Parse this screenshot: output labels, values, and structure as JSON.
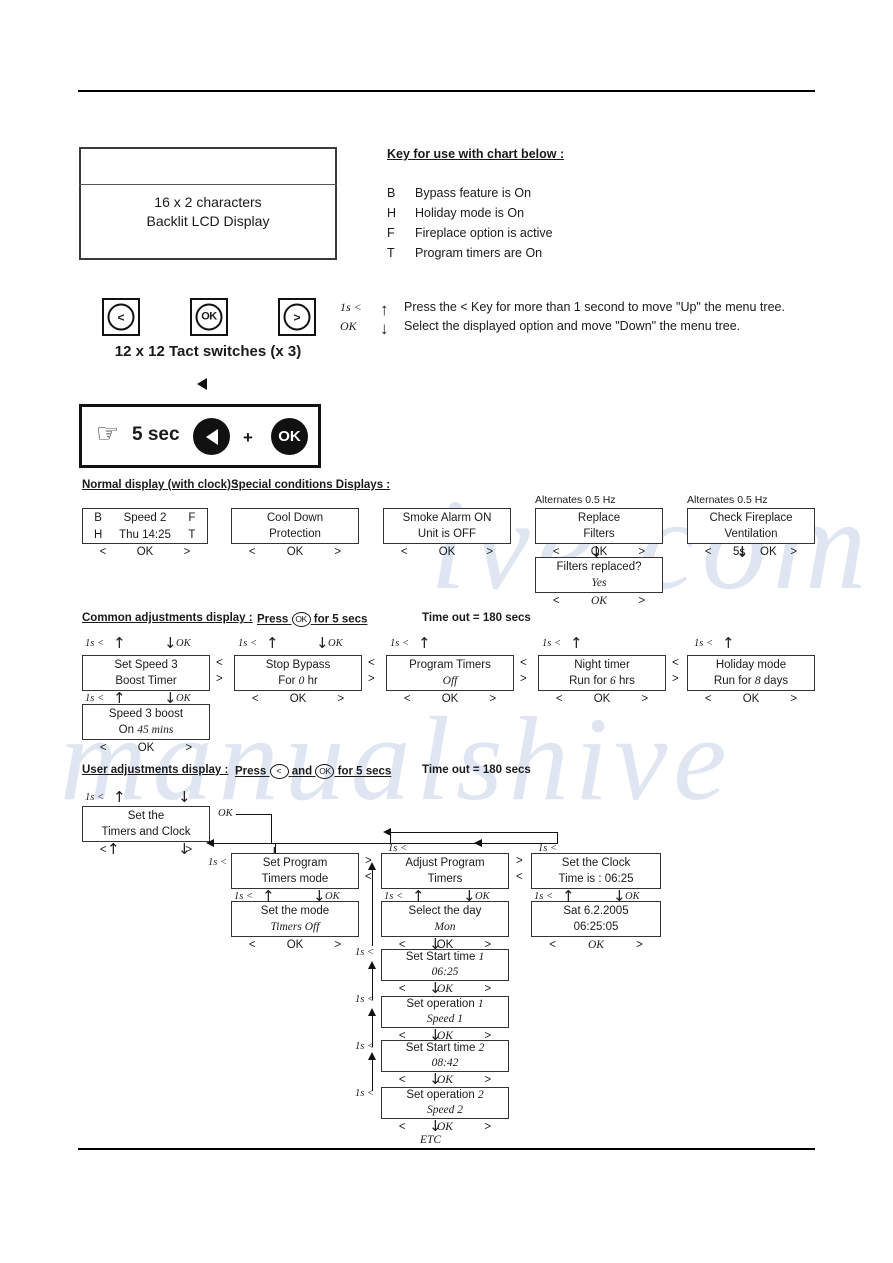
{
  "lcd_panel": {
    "caption_line1": "16 x 2 characters",
    "caption_line2": "Backlit LCD Display"
  },
  "key_legend": {
    "title": "Key for use with chart below :",
    "rows": [
      {
        "letter": "B",
        "desc": "Bypass feature is On"
      },
      {
        "letter": "H",
        "desc": "Holiday mode is On"
      },
      {
        "letter": "F",
        "desc": "Fireplace option is active"
      },
      {
        "letter": "T",
        "desc": "Program timers are On"
      }
    ]
  },
  "switches": {
    "left_label": "<",
    "ok_label": "OK",
    "right_label": ">",
    "caption": "12 x 12 Tact switches (x 3)"
  },
  "instructions": [
    {
      "tag": "1s <",
      "arrow": "↑",
      "text": "Press the  <  Key for more than 1 second to move \"Up\" the menu tree."
    },
    {
      "tag": "OK",
      "arrow": "↓",
      "text": "Select the displayed option and move \"Down\" the menu tree."
    }
  ],
  "reset_box": {
    "hand": "☞",
    "seconds": "5 sec",
    "plus": "+",
    "ok": "OK"
  },
  "sections": {
    "normal_display": "Normal display (with clock) :",
    "special_conditions": "Special conditions Displays :",
    "common_adjustments": "Common adjustments display :",
    "common_press_pre": "Press",
    "common_press_post": "for 5 secs",
    "common_timeout": "Time out = 180 secs",
    "user_adjustments": "User adjustments display :",
    "user_press_pre": "Press",
    "user_press_mid": "and",
    "user_press_post": "for 5 secs",
    "user_timeout": "Time out = 180 secs"
  },
  "labels": {
    "up": "1s <",
    "ok": "OK",
    "ok_5s": "5s",
    "alternates": "Alternates 0.5 Hz",
    "etc": "ETC",
    "lt": "<",
    "gt": ">",
    "arrow_up": "↑",
    "arrow_down": "↓"
  },
  "screens": {
    "normal_clock": {
      "b": "B",
      "speed": "Speed 2",
      "f": "F",
      "h": "H",
      "clock": "Thu 14:25",
      "t": "T",
      "keys": {
        "left": "<",
        "mid": "OK",
        "right": ">"
      }
    },
    "cool_down": {
      "l1": "Cool Down",
      "l2": "Protection",
      "keys": {
        "left": "<",
        "mid": "OK",
        "right": ">"
      }
    },
    "smoke_alarm": {
      "l1": "Smoke Alarm ON",
      "l2": "Unit is OFF",
      "keys": {
        "left": "<",
        "mid": "OK",
        "right": ">"
      }
    },
    "replace_filters": {
      "l1": "Replace",
      "l2": "Filters",
      "note": "Alternates 0.5 Hz",
      "keys": {
        "left": "<",
        "mid": "OK",
        "right": ">"
      }
    },
    "filters_replaced": {
      "l1": "Filters replaced?",
      "l2": "Yes",
      "keys": {
        "left": "<",
        "mid": "OK",
        "right": ">"
      }
    },
    "check_fireplace": {
      "l1": "Check Fireplace",
      "l2": "Ventilation",
      "note": "Alternates 0.5 Hz",
      "keys": {
        "left": "<",
        "mid": "5s",
        "mid2": "OK",
        "right": ">"
      }
    },
    "set_speed3": {
      "l1": "Set Speed 3",
      "l2": "Boost Timer"
    },
    "speed3_boost": {
      "l1": "Speed 3 boost",
      "l2a": "On ",
      "l2b": "45 mins",
      "keys": {
        "left": "<",
        "mid": "OK",
        "right": ">"
      }
    },
    "stop_bypass": {
      "l1": "Stop Bypass",
      "l2a": "For ",
      "l2b": "0",
      "l2c": " hr",
      "keys": {
        "left": "<",
        "mid": "OK",
        "right": ">"
      }
    },
    "program_timers": {
      "l1": "Program Timers",
      "l2": "Off",
      "keys": {
        "left": "<",
        "mid": "OK",
        "right": ">"
      }
    },
    "night_timer": {
      "l1": "Night timer",
      "l2a": "Run for ",
      "l2b": "6",
      "l2c": " hrs",
      "keys": {
        "left": "<",
        "mid": "OK",
        "right": ">"
      }
    },
    "holiday_mode": {
      "l1": "Holiday mode",
      "l2a": "Run for ",
      "l2b": "8",
      "l2c": " days",
      "keys": {
        "left": "<",
        "mid": "OK",
        "right": ">"
      }
    },
    "set_timers_clock": {
      "l1": "Set the",
      "l2": "Timers and Clock"
    },
    "set_program_timers_mode": {
      "l1": "Set Program",
      "l2": "Timers mode"
    },
    "adjust_program_timers": {
      "l1": "Adjust Program",
      "l2": "Timers"
    },
    "set_the_clock": {
      "l1": "Set the Clock",
      "l2": "Time is :   06:25"
    },
    "set_the_mode": {
      "l1": "Set the mode",
      "l2": "Timers Off",
      "keys": {
        "left": "<",
        "mid": "OK",
        "right": ">"
      }
    },
    "select_the_day": {
      "l1": "Select the day",
      "l2": "Mon",
      "keys": {
        "left": "<",
        "mid": "OK",
        "right": ">"
      }
    },
    "clock_value": {
      "l1": "Sat    6.2.2005",
      "l2": "06:25:05",
      "keys": {
        "left": "<",
        "mid": "OK",
        "right": ">"
      }
    },
    "start_time_1": {
      "l1a": "Set Start time ",
      "l1b": "1",
      "l2": "06:25",
      "keys": {
        "left": "<",
        "mid": "OK",
        "right": ">"
      }
    },
    "operation_1": {
      "l1a": "Set operation ",
      "l1b": "1",
      "l2": "Speed 1",
      "keys": {
        "left": "<",
        "mid": "OK",
        "right": ">"
      }
    },
    "start_time_2": {
      "l1a": "Set Start time ",
      "l1b": "2",
      "l2": "08:42",
      "keys": {
        "left": "<",
        "mid": "OK",
        "right": ">"
      }
    },
    "operation_2": {
      "l1a": "Set operation ",
      "l1b": "2",
      "l2": "Speed 2",
      "keys": {
        "left": "<",
        "mid": "OK",
        "right": ">"
      }
    }
  }
}
